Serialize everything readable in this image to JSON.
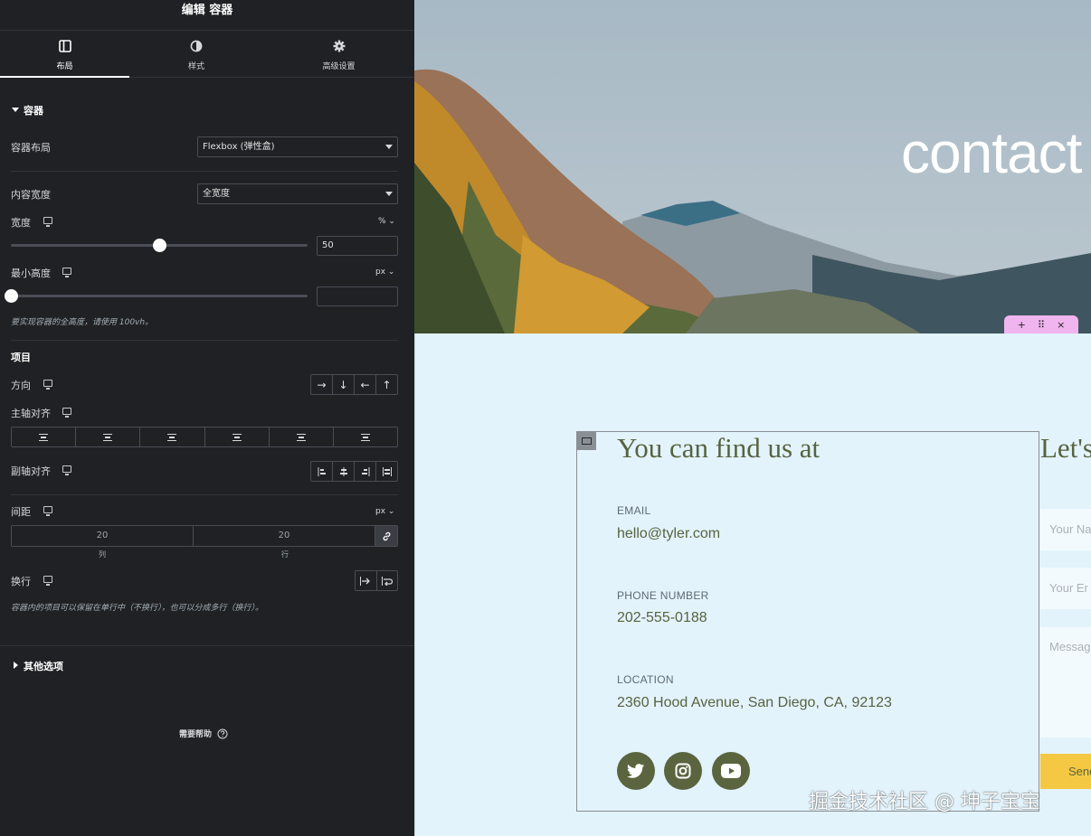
{
  "panel": {
    "title": "编辑 容器",
    "tabs": [
      {
        "label": "布局",
        "icon": "layout-icon"
      },
      {
        "label": "样式",
        "icon": "style-half-circle-icon"
      },
      {
        "label": "高级设置",
        "icon": "gear-icon"
      }
    ],
    "section_container": "容器",
    "container_layout_label": "容器布局",
    "container_layout_value": "Flexbox (弹性盒)",
    "content_width_label": "内容宽度",
    "content_width_value": "全宽度",
    "width_label": "宽度",
    "width_unit": "%",
    "width_value": "50",
    "width_slider_fraction": 0.5,
    "min_height_label": "最小高度",
    "min_height_unit": "px",
    "min_height_value": "",
    "min_height_slider_fraction": 0,
    "min_height_note": "要实现容器的全高度，请使用 100vh。",
    "items_label": "项目",
    "direction_label": "方向",
    "direction_options": [
      "→",
      "↓",
      "←",
      "↑"
    ],
    "justify_label": "主轴对齐",
    "align_label": "副轴对齐",
    "gap_label": "间距",
    "gap_unit": "px",
    "gap_col_value": "20",
    "gap_row_value": "20",
    "gap_col_caption": "列",
    "gap_row_caption": "行",
    "wrap_label": "换行",
    "wrap_note": "容器内的项目可以保留在单行中（不换行），也可以分成多行（换行）。",
    "other_options": "其他选项",
    "help": "需要帮助",
    "collapse_glyph": "‹"
  },
  "preview": {
    "hero_title": "contact",
    "handle_icons": [
      "+",
      "⠿",
      "×"
    ],
    "heading": "You can find us at",
    "email_caption": "EMAIL",
    "email": "hello@tyler.com",
    "phone_caption": "PHONE NUMBER",
    "phone": "202-555-0188",
    "location_caption": "LOCATION",
    "location": "2360 Hood Avenue, San Diego, CA, 92123",
    "social": [
      "twitter-icon",
      "instagram-icon",
      "youtube-icon"
    ],
    "form_heading": "Let's",
    "name_placeholder": "Your Na",
    "email_placeholder": "Your Er",
    "message_placeholder": "Messag",
    "send_label": "Send"
  },
  "watermark": "掘金技术社区 @ 坤子宝宝",
  "colors": {
    "panel_bg": "#1f2124",
    "preview_bg": "#e3f3fc",
    "brand_green": "#56633f",
    "send_yellow": "#f5c843",
    "handle_pink": "#f0b5ef"
  }
}
